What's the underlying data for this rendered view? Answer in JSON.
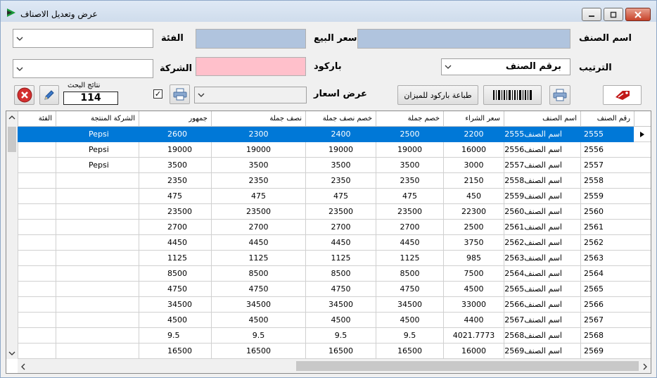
{
  "window": {
    "title": "عرض وتعديل الاصناف",
    "icons": {
      "app": "play-icon",
      "minimize": "minimize-icon",
      "maximize": "maximize-icon",
      "close": "close-icon"
    }
  },
  "form": {
    "item_name_label": "اسم الصنف",
    "item_name_value": "",
    "sale_price_label": "سعر البيع",
    "sale_price_value": "",
    "category_label": "الفئة",
    "category_value": "",
    "sort_label": "الترتيب",
    "sort_value": "برقم الصنف",
    "barcode_label": "باركود",
    "barcode_value": "",
    "company_label": "الشركة",
    "company_value": "",
    "show_prices_label": "عرض اسعار",
    "show_prices_value": "",
    "print_scale_barcode_button": "طباعة باركود للميزان",
    "search_results_label": "نتائج البحث",
    "search_results_count": "114",
    "colors": {
      "sale_price_bg": "#b0c4de",
      "item_name_bg": "#b0c4de",
      "barcode_bg": "#ffc0cb"
    }
  },
  "grid": {
    "columns": [
      "رقم الصنف",
      "اسم الصنف",
      "سعر الشراء",
      "خصم جملة",
      "خصم نصف جملة",
      "نصف جملة",
      "جمهور",
      "الشركة المنتجة",
      "الفئة"
    ],
    "rows": [
      [
        "2555",
        "اسم الصنف2555",
        "2200",
        "2500",
        "2400",
        "2300",
        "2600",
        "Pepsi",
        ""
      ],
      [
        "2556",
        "اسم الصنف2556",
        "16000",
        "19000",
        "19000",
        "19000",
        "19000",
        "Pepsi",
        ""
      ],
      [
        "2557",
        "اسم الصنف2557",
        "3000",
        "3500",
        "3500",
        "3500",
        "3500",
        "Pepsi",
        ""
      ],
      [
        "2558",
        "اسم الصنف2558",
        "2150",
        "2350",
        "2350",
        "2350",
        "2350",
        "",
        ""
      ],
      [
        "2559",
        "اسم الصنف2559",
        "450",
        "475",
        "475",
        "475",
        "475",
        "",
        ""
      ],
      [
        "2560",
        "اسم الصنف2560",
        "22300",
        "23500",
        "23500",
        "23500",
        "23500",
        "",
        ""
      ],
      [
        "2561",
        "اسم الصنف2561",
        "2500",
        "2700",
        "2700",
        "2700",
        "2700",
        "",
        ""
      ],
      [
        "2562",
        "اسم الصنف2562",
        "3750",
        "4450",
        "4450",
        "4450",
        "4450",
        "",
        ""
      ],
      [
        "2563",
        "اسم الصنف2563",
        "985",
        "1125",
        "1125",
        "1125",
        "1125",
        "",
        ""
      ],
      [
        "2564",
        "اسم الصنف2564",
        "7500",
        "8500",
        "8500",
        "8500",
        "8500",
        "",
        ""
      ],
      [
        "2565",
        "اسم الصنف2565",
        "4500",
        "4750",
        "4750",
        "4750",
        "4750",
        "",
        ""
      ],
      [
        "2566",
        "اسم الصنف2566",
        "33000",
        "34500",
        "34500",
        "34500",
        "34500",
        "",
        ""
      ],
      [
        "2567",
        "اسم الصنف2567",
        "4400",
        "4500",
        "4500",
        "4500",
        "4500",
        "",
        ""
      ],
      [
        "2568",
        "اسم الصنف2568",
        "4021.7773",
        "9.5",
        "9.5",
        "9.5",
        "9.5",
        "",
        ""
      ],
      [
        "2569",
        "اسم الصنف2569",
        "16000",
        "16500",
        "16500",
        "16500",
        "16500",
        "",
        ""
      ]
    ],
    "selected_row": 0,
    "selection_color": "#0078d7"
  }
}
